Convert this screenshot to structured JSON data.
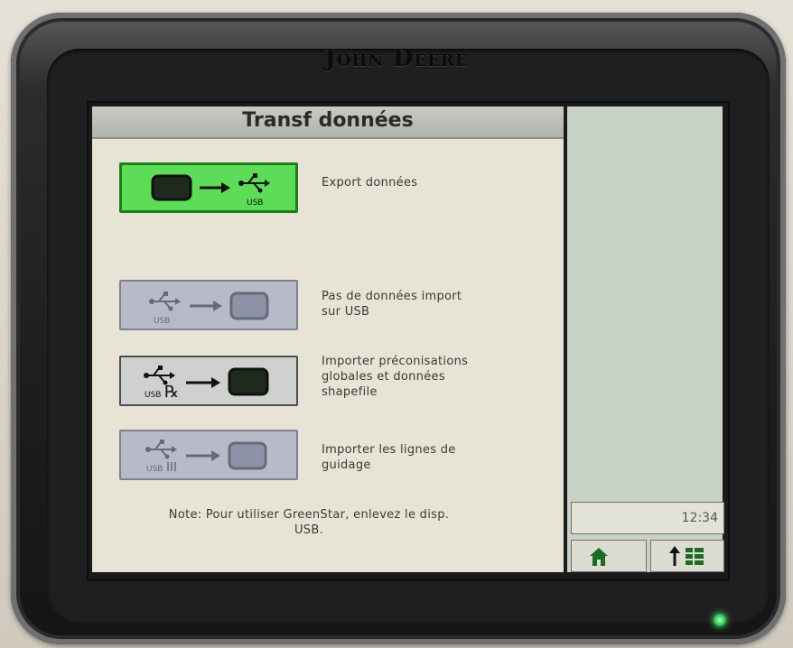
{
  "device": {
    "brand": "John Deere"
  },
  "screen": {
    "title": "Transf données",
    "options": [
      {
        "label_lines": [
          "Export données"
        ],
        "state": "selected",
        "icon": "display-to-usb-icon"
      },
      {
        "label_lines": [
          "Pas de données import",
          "sur USB"
        ],
        "state": "disabled",
        "icon": "usb-to-display-icon"
      },
      {
        "label_lines": [
          "Importer préconisations",
          "globales et données",
          "shapefile"
        ],
        "state": "enabled",
        "icon": "usb-prescription-to-display-icon"
      },
      {
        "label_lines": [
          "Importer les lignes de",
          "guidage"
        ],
        "state": "disabled",
        "icon": "usb-guidance-to-display-icon"
      }
    ],
    "note_lines": [
      "Note: Pour utiliser GreenStar, enlevez le disp.",
      "USB."
    ]
  },
  "sidebar": {
    "clock": "12:34",
    "home_icon": "home-icon",
    "menu_icon": "up-arrow-menu-icon"
  },
  "colors": {
    "selected_bg": "#5ddc57",
    "disabled_bg": "#b8bac8",
    "led": "#3fd66a"
  }
}
